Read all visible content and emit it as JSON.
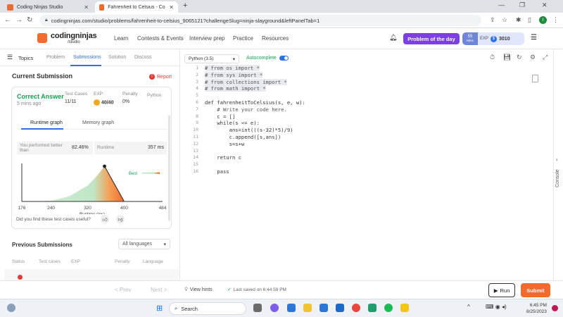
{
  "browser": {
    "tabs": [
      {
        "title": "Coding Ninjas Studio",
        "active": false
      },
      {
        "title": "Fahrenheit to Celsius - Coding N",
        "active": true
      }
    ],
    "url": "codingninjas.com/studio/problems/fahrenheit-to-celsius_9065121?challengeSlug=ninja-slayground&leftPanelTab=1",
    "profile_initial": "I"
  },
  "site": {
    "logo": "codingninjas",
    "logo_sub": "/studio",
    "nav": [
      "Learn",
      "Contests & Events",
      "Interview prep",
      "Practice",
      "Resources"
    ],
    "problem_of_day": "Problem of the day",
    "streak_value": "55",
    "streak_unit": "Mins",
    "exp_label": "EXP",
    "exp_value": "3010"
  },
  "left": {
    "topics_label": "Topics",
    "tabs": [
      "Problem",
      "Submissions",
      "Solution",
      "Discuss"
    ],
    "active_tab": "Submissions",
    "current_title": "Current Submission",
    "report_label": "Report",
    "card": {
      "status": "Correct Answer",
      "time_ago": "5 mins ago",
      "test_cases_label": "Test Cases",
      "test_cases_value": "11/11",
      "exp_label": "EXP:",
      "exp_value": "40/40",
      "penalty_label": "Penalty",
      "penalty_value": "0%",
      "language": "Python",
      "graph_tabs": [
        "Runtime graph",
        "Memory graph"
      ],
      "performed_label": "You performed better than",
      "performed_value": "82.46%",
      "runtime_label": "Runtime",
      "runtime_value": "357 ms",
      "best_label": "Best",
      "test_question": "Did you find these test cases useful?"
    },
    "previous_title": "Previous Submissions",
    "language_filter": "All languages",
    "previous_columns": [
      "Status",
      "Test cases",
      "EXP",
      "Penalty",
      "Language"
    ]
  },
  "chart_data": {
    "type": "area",
    "title": "",
    "xlabel": "Runtime (ms)",
    "ylabel": "",
    "x_ticks": [
      176,
      240,
      320,
      400,
      484
    ],
    "xlim": [
      176,
      484
    ],
    "highlight_x": 357,
    "points": [
      [
        176,
        0
      ],
      [
        240,
        0.02
      ],
      [
        280,
        0.15
      ],
      [
        320,
        0.45
      ],
      [
        340,
        0.72
      ],
      [
        357,
        1.0
      ],
      [
        400,
        0
      ]
    ],
    "colors": {
      "fill_low": "#bfe6c6",
      "fill_high": "#f26a2e",
      "marker": "#222222"
    }
  },
  "editor": {
    "language": "Python (3.5)",
    "autocomplete": "Autocomplete",
    "autocomplete_on": true,
    "lines": [
      "# from os import *",
      "# from sys import *",
      "# from collections import *",
      "# from math import *",
      "",
      "def fahrenheitToCelsius(s, e, w):",
      "    # Write your code here.",
      "    c = []",
      "    while(s <= e):",
      "        ans=int(((s-32)*5)/9)",
      "        c.append([s,ans])",
      "        s=s+w",
      "",
      "    return c",
      "",
      "    pass"
    ],
    "highlighted_lines": [
      0,
      1,
      2,
      3
    ]
  },
  "bottom": {
    "prev_label": "< Prev",
    "next_label": "Next >",
    "view_hints": "View hints",
    "saved": "Last saved on 6:44:59 PM",
    "run": "Run",
    "submit": "Submit"
  },
  "console_label": "Console",
  "taskbar": {
    "search": "Search",
    "time": "6:45 PM",
    "date": "8/25/2023"
  }
}
